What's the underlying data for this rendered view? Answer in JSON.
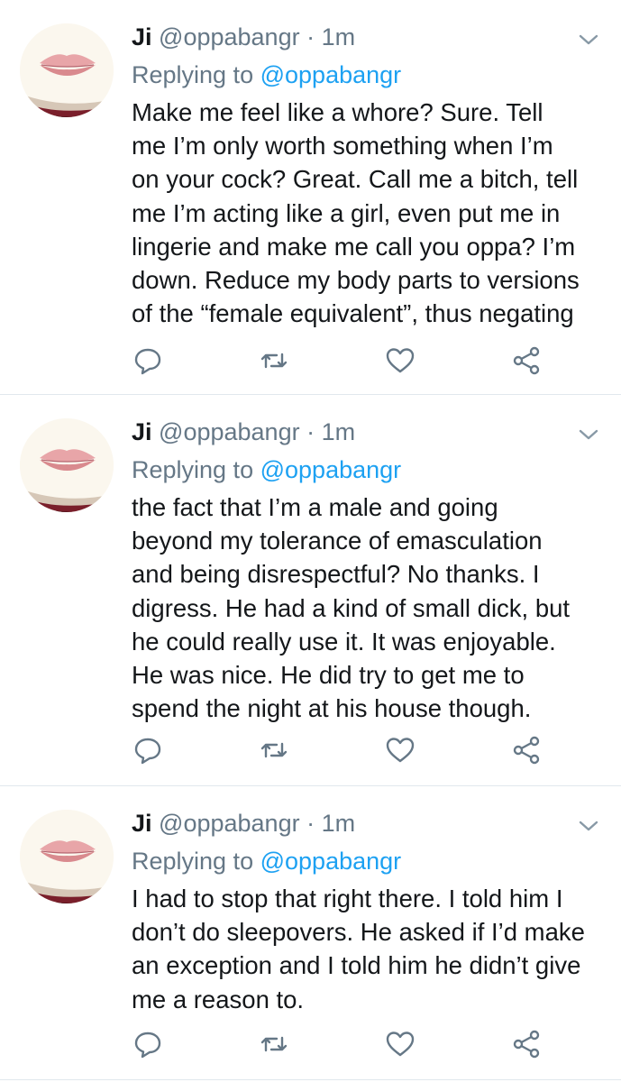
{
  "tweets": [
    {
      "author": {
        "name": "Ji",
        "handle": "@oppabangr"
      },
      "separator": "·",
      "time": "1m",
      "replying_prefix": "Replying to",
      "replying_to": "@oppabangr",
      "lines": [
        "Make me feel like a whore? Sure. Tell",
        "me I’m only worth something when I’m",
        "on your cock? Great. Call me a bitch, tell",
        "me I’m acting like a girl, even put me in",
        "lingerie and make me call you oppa? I’m",
        "down. Reduce my body parts to versions",
        "of the “female equivalent”, thus negating"
      ]
    },
    {
      "author": {
        "name": "Ji",
        "handle": "@oppabangr"
      },
      "separator": "·",
      "time": "1m",
      "replying_prefix": "Replying to",
      "replying_to": "@oppabangr",
      "lines": [
        "the fact that I’m a male and going",
        "beyond my tolerance of emasculation",
        "and being disrespectful? No thanks. I",
        "digress. He had a kind of small dick, but",
        "he could really use it. It was enjoyable.",
        "He was nice. He did try to get me to",
        "spend the night at his house though."
      ]
    },
    {
      "author": {
        "name": "Ji",
        "handle": "@oppabangr"
      },
      "separator": "·",
      "time": "1m",
      "replying_prefix": "Replying to",
      "replying_to": "@oppabangr",
      "lines": [
        "I had to stop that right there. I told him I",
        "don’t do sleepovers. He asked if I’d make",
        "an exception and I told him he didn’t give",
        "me a reason to."
      ]
    }
  ],
  "icons": {
    "reply": "reply-icon",
    "retweet": "retweet-icon",
    "like": "heart-icon",
    "share": "share-icon",
    "menu": "chevron-down-icon"
  },
  "colors": {
    "text": "#14171a",
    "secondary": "#657786",
    "link": "#1da1f2",
    "divider": "#e1e8ed"
  }
}
